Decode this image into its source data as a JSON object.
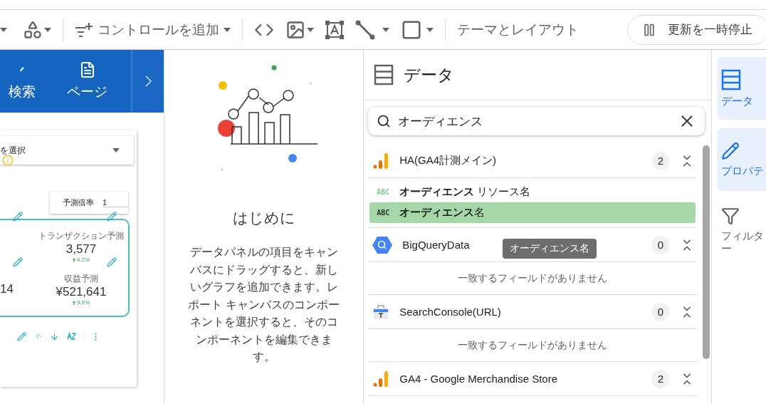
{
  "toolbar": {
    "add_control": "コントロールを追加",
    "theme": "テーマとレイアウト",
    "pause": "更新を一時停止"
  },
  "canvas": {
    "nav": [
      {
        "label": "検索",
        "kind": "search"
      },
      {
        "label": "ページ",
        "kind": "page"
      }
    ],
    "dropdown": "を選択",
    "multiplier": {
      "label": "予測倍率",
      "value": "1"
    },
    "partial_value": "14",
    "kpis": [
      {
        "label": "トランザクション予測",
        "value": "3,577",
        "change": "4.2%"
      },
      {
        "label": "収益予測",
        "value": "¥521,641",
        "change": "9.9%"
      }
    ]
  },
  "intro": {
    "title": "はじめに",
    "body": "データパネルの項目をキャンバスにドラッグすると、新しいグラフを追加できます。レポート キャンバスのコンポーネントを選択すると、そのコンポーネントを編集できます。"
  },
  "data_panel": {
    "title": "データ",
    "search": {
      "value": "オーディエンス"
    },
    "tooltip": "オーディエンス名",
    "sources": [
      {
        "name": "HA(GA4計測メイン)",
        "kind": "analytics",
        "count": "2",
        "expanded": true,
        "fields": [
          {
            "type": "ABC",
            "label": "**オーディエンス** リソース名",
            "selected": false
          },
          {
            "type": "ABC",
            "label": "**オーディエンス**名",
            "selected": true
          }
        ]
      },
      {
        "name": "BigQueryData",
        "kind": "bigquery",
        "count": "0",
        "expanded": true,
        "empty_message": "一致するフィールドがありません"
      },
      {
        "name": "SearchConsole(URL)",
        "kind": "searchconsole",
        "count": "0",
        "expanded": true,
        "empty_message": "一致するフィールドがありません"
      },
      {
        "name": "GA4 - Google Merchandise Store",
        "kind": "analytics",
        "count": "2",
        "expanded": true
      }
    ]
  },
  "rail": [
    {
      "label": "データ",
      "kind": "data",
      "selected": true
    },
    {
      "label": "プロパテ",
      "kind": "properties",
      "selected": true
    },
    {
      "label": "フィルター",
      "kind": "filter",
      "selected": false
    }
  ]
}
